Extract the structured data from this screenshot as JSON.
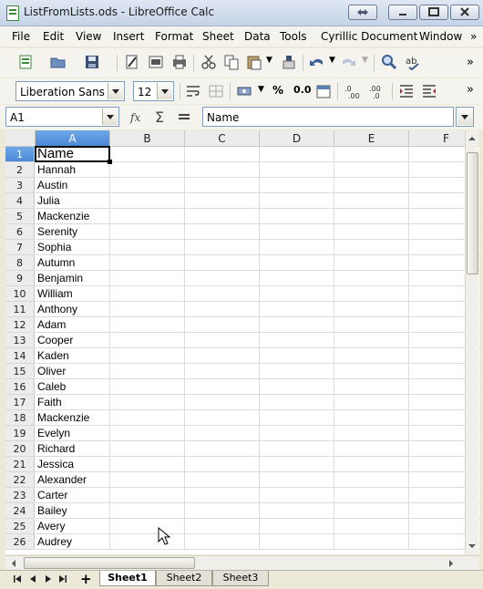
{
  "window": {
    "title": "ListFromLists.ods - LibreOffice Calc"
  },
  "menu": [
    "File",
    "Edit",
    "View",
    "Insert",
    "Format",
    "Sheet",
    "Data",
    "Tools",
    "Cyrillic Document",
    "Window"
  ],
  "menu_overflow": "»",
  "formatting": {
    "font_name": "Liberation Sans",
    "font_size": "12",
    "percent_label": "%",
    "decimal_label": "0.0"
  },
  "formula_bar": {
    "cell_ref": "A1",
    "content": "Name"
  },
  "columns": [
    "A",
    "B",
    "C",
    "D",
    "E",
    "F"
  ],
  "rows": [
    {
      "n": "1",
      "a": "Name"
    },
    {
      "n": "2",
      "a": "Hannah"
    },
    {
      "n": "3",
      "a": "Austin"
    },
    {
      "n": "4",
      "a": "Julia"
    },
    {
      "n": "5",
      "a": "Mackenzie"
    },
    {
      "n": "6",
      "a": "Serenity"
    },
    {
      "n": "7",
      "a": "Sophia"
    },
    {
      "n": "8",
      "a": "Autumn"
    },
    {
      "n": "9",
      "a": "Benjamin"
    },
    {
      "n": "10",
      "a": "William"
    },
    {
      "n": "11",
      "a": "Anthony"
    },
    {
      "n": "12",
      "a": "Adam"
    },
    {
      "n": "13",
      "a": "Cooper"
    },
    {
      "n": "14",
      "a": "Kaden"
    },
    {
      "n": "15",
      "a": "Oliver"
    },
    {
      "n": "16",
      "a": "Caleb"
    },
    {
      "n": "17",
      "a": "Faith"
    },
    {
      "n": "18",
      "a": "Mackenzie"
    },
    {
      "n": "19",
      "a": "Evelyn"
    },
    {
      "n": "20",
      "a": "Richard"
    },
    {
      "n": "21",
      "a": "Jessica"
    },
    {
      "n": "22",
      "a": "Alexander"
    },
    {
      "n": "23",
      "a": "Carter"
    },
    {
      "n": "24",
      "a": "Bailey"
    },
    {
      "n": "25",
      "a": "Avery"
    },
    {
      "n": "26",
      "a": "Audrey"
    }
  ],
  "sheets": [
    "Sheet1",
    "Sheet2",
    "Sheet3"
  ],
  "active_sheet": "Sheet1",
  "add_sheet_label": "+",
  "colors": {
    "selection": "#4a88d8",
    "title_bar": "#c5d3e8"
  }
}
